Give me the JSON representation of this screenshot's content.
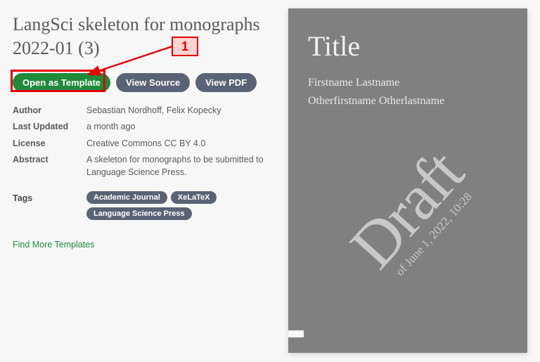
{
  "title": "LangSci skeleton for monographs 2022-01 (3)",
  "buttons": {
    "open_template": "Open as Template",
    "view_source": "View Source",
    "view_pdf": "View PDF"
  },
  "meta": {
    "author_label": "Author",
    "author_value": "Sebastian Nordhoff, Felix Kopecky",
    "updated_label": "Last Updated",
    "updated_value": "a month ago",
    "license_label": "License",
    "license_value": "Creative Commons CC BY 4.0",
    "abstract_label": "Abstract",
    "abstract_value": "A skeleton for monographs to be submitted to Language Science Press."
  },
  "tags_label": "Tags",
  "tags": [
    "Academic Journal",
    "XeLaTeX",
    "Language Science Press"
  ],
  "find_more": "Find More Templates",
  "annotation": {
    "num": "1"
  },
  "preview": {
    "title": "Title",
    "author1": "Firstname Lastname",
    "author2": "Otherfirstname Otherlastname",
    "draft": "Draft",
    "draft_date": "of June 1, 2022, 10:28"
  }
}
